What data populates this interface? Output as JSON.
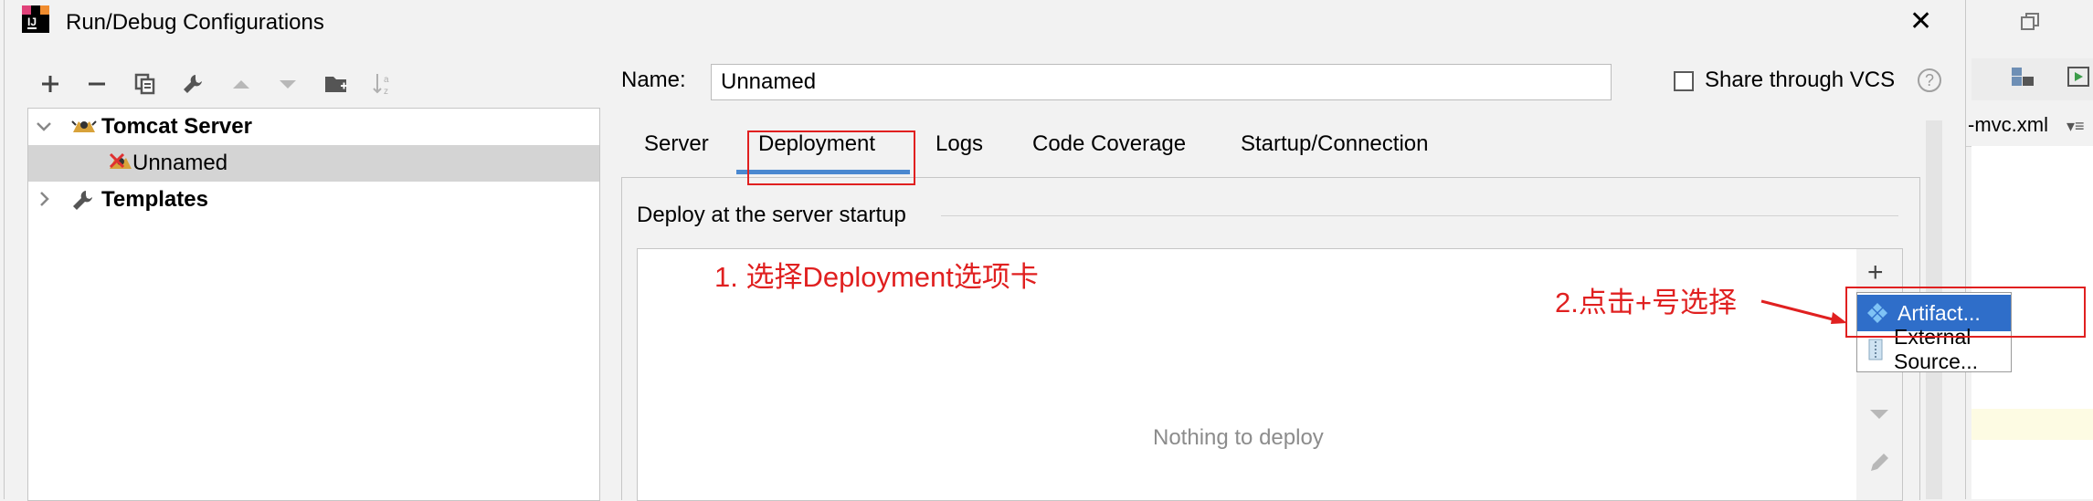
{
  "window": {
    "title": "Run/Debug Configurations",
    "close_glyph": "✕"
  },
  "background_ide": {
    "editor_tab": "-mvc.xml"
  },
  "toolbar": {
    "icons": [
      "add-icon",
      "remove-icon",
      "copy-icon",
      "wrench-icon",
      "move-up-icon",
      "move-down-icon",
      "folder-icon",
      "sort-icon"
    ]
  },
  "tree": {
    "items": [
      {
        "label": "Tomcat Server",
        "expanded": true,
        "bold": true
      },
      {
        "label": "Unnamed",
        "selected": true
      },
      {
        "label": "Templates",
        "expanded": false,
        "bold": true
      }
    ]
  },
  "name_field": {
    "label": "Name:",
    "value": "Unnamed"
  },
  "share": {
    "label": "Share through VCS",
    "checked": false,
    "help": "?"
  },
  "tabs": [
    {
      "label": "Server"
    },
    {
      "label": "Deployment",
      "active": true
    },
    {
      "label": "Logs"
    },
    {
      "label": "Code Coverage"
    },
    {
      "label": "Startup/Connection"
    }
  ],
  "deployment": {
    "section_title": "Deploy at the server startup",
    "empty_text": "Nothing to deploy",
    "add_glyph": "+"
  },
  "popup_menu": {
    "items": [
      {
        "label": "Artifact...",
        "highlighted": true
      },
      {
        "label": "External Source..."
      }
    ]
  },
  "annotations": {
    "note1": "1. 选择Deployment选项卡",
    "note2": "2.点击+号选择",
    "color": "#e02020"
  },
  "colors": {
    "accent": "#4a88d0",
    "selection": "#2f6ec9",
    "tree_selection": "#d4d4d4"
  }
}
